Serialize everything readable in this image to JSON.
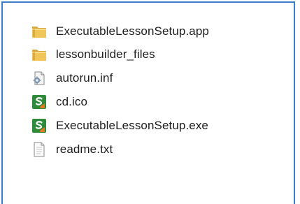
{
  "file_list": {
    "items": [
      {
        "label": "ExecutableLessonSetup.app",
        "icon": "folder-icon"
      },
      {
        "label": "lessonbuilder_files",
        "icon": "folder-icon"
      },
      {
        "label": "autorun.inf",
        "icon": "settings-file-icon"
      },
      {
        "label": "cd.ico",
        "icon": "app-logo-icon"
      },
      {
        "label": "ExecutableLessonSetup.exe",
        "icon": "app-logo-icon"
      },
      {
        "label": "readme.txt",
        "icon": "text-file-icon"
      }
    ]
  },
  "colors": {
    "frame_border": "#3b7fc8",
    "folder": "#e8b847",
    "app_logo_green": "#2e8b3a",
    "app_logo_orange": "#e07a1f"
  }
}
